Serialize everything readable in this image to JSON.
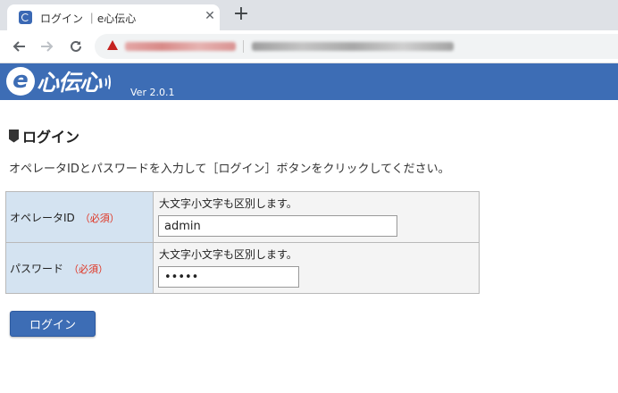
{
  "browser": {
    "tab": {
      "title": "ログイン ｜e心伝心",
      "close_label": "✕"
    },
    "new_tab_label": "+"
  },
  "header": {
    "logo_letter": "e",
    "logo_text": "心伝心",
    "version": "Ver 2.0.1",
    "color": "#3d6db5"
  },
  "page": {
    "title": "ログイン",
    "instruction": "オペレータIDとパスワードを入力して［ログイン］ボタンをクリックしてください。"
  },
  "form": {
    "operator_id": {
      "label": "オペレータID",
      "required": "（必須）",
      "hint": "大文字小文字も区別します。",
      "value": "admin"
    },
    "password": {
      "label": "パスワード",
      "required": "（必須）",
      "hint": "大文字小文字も区別します。",
      "value": "•••••"
    }
  },
  "login_button": "ログイン"
}
